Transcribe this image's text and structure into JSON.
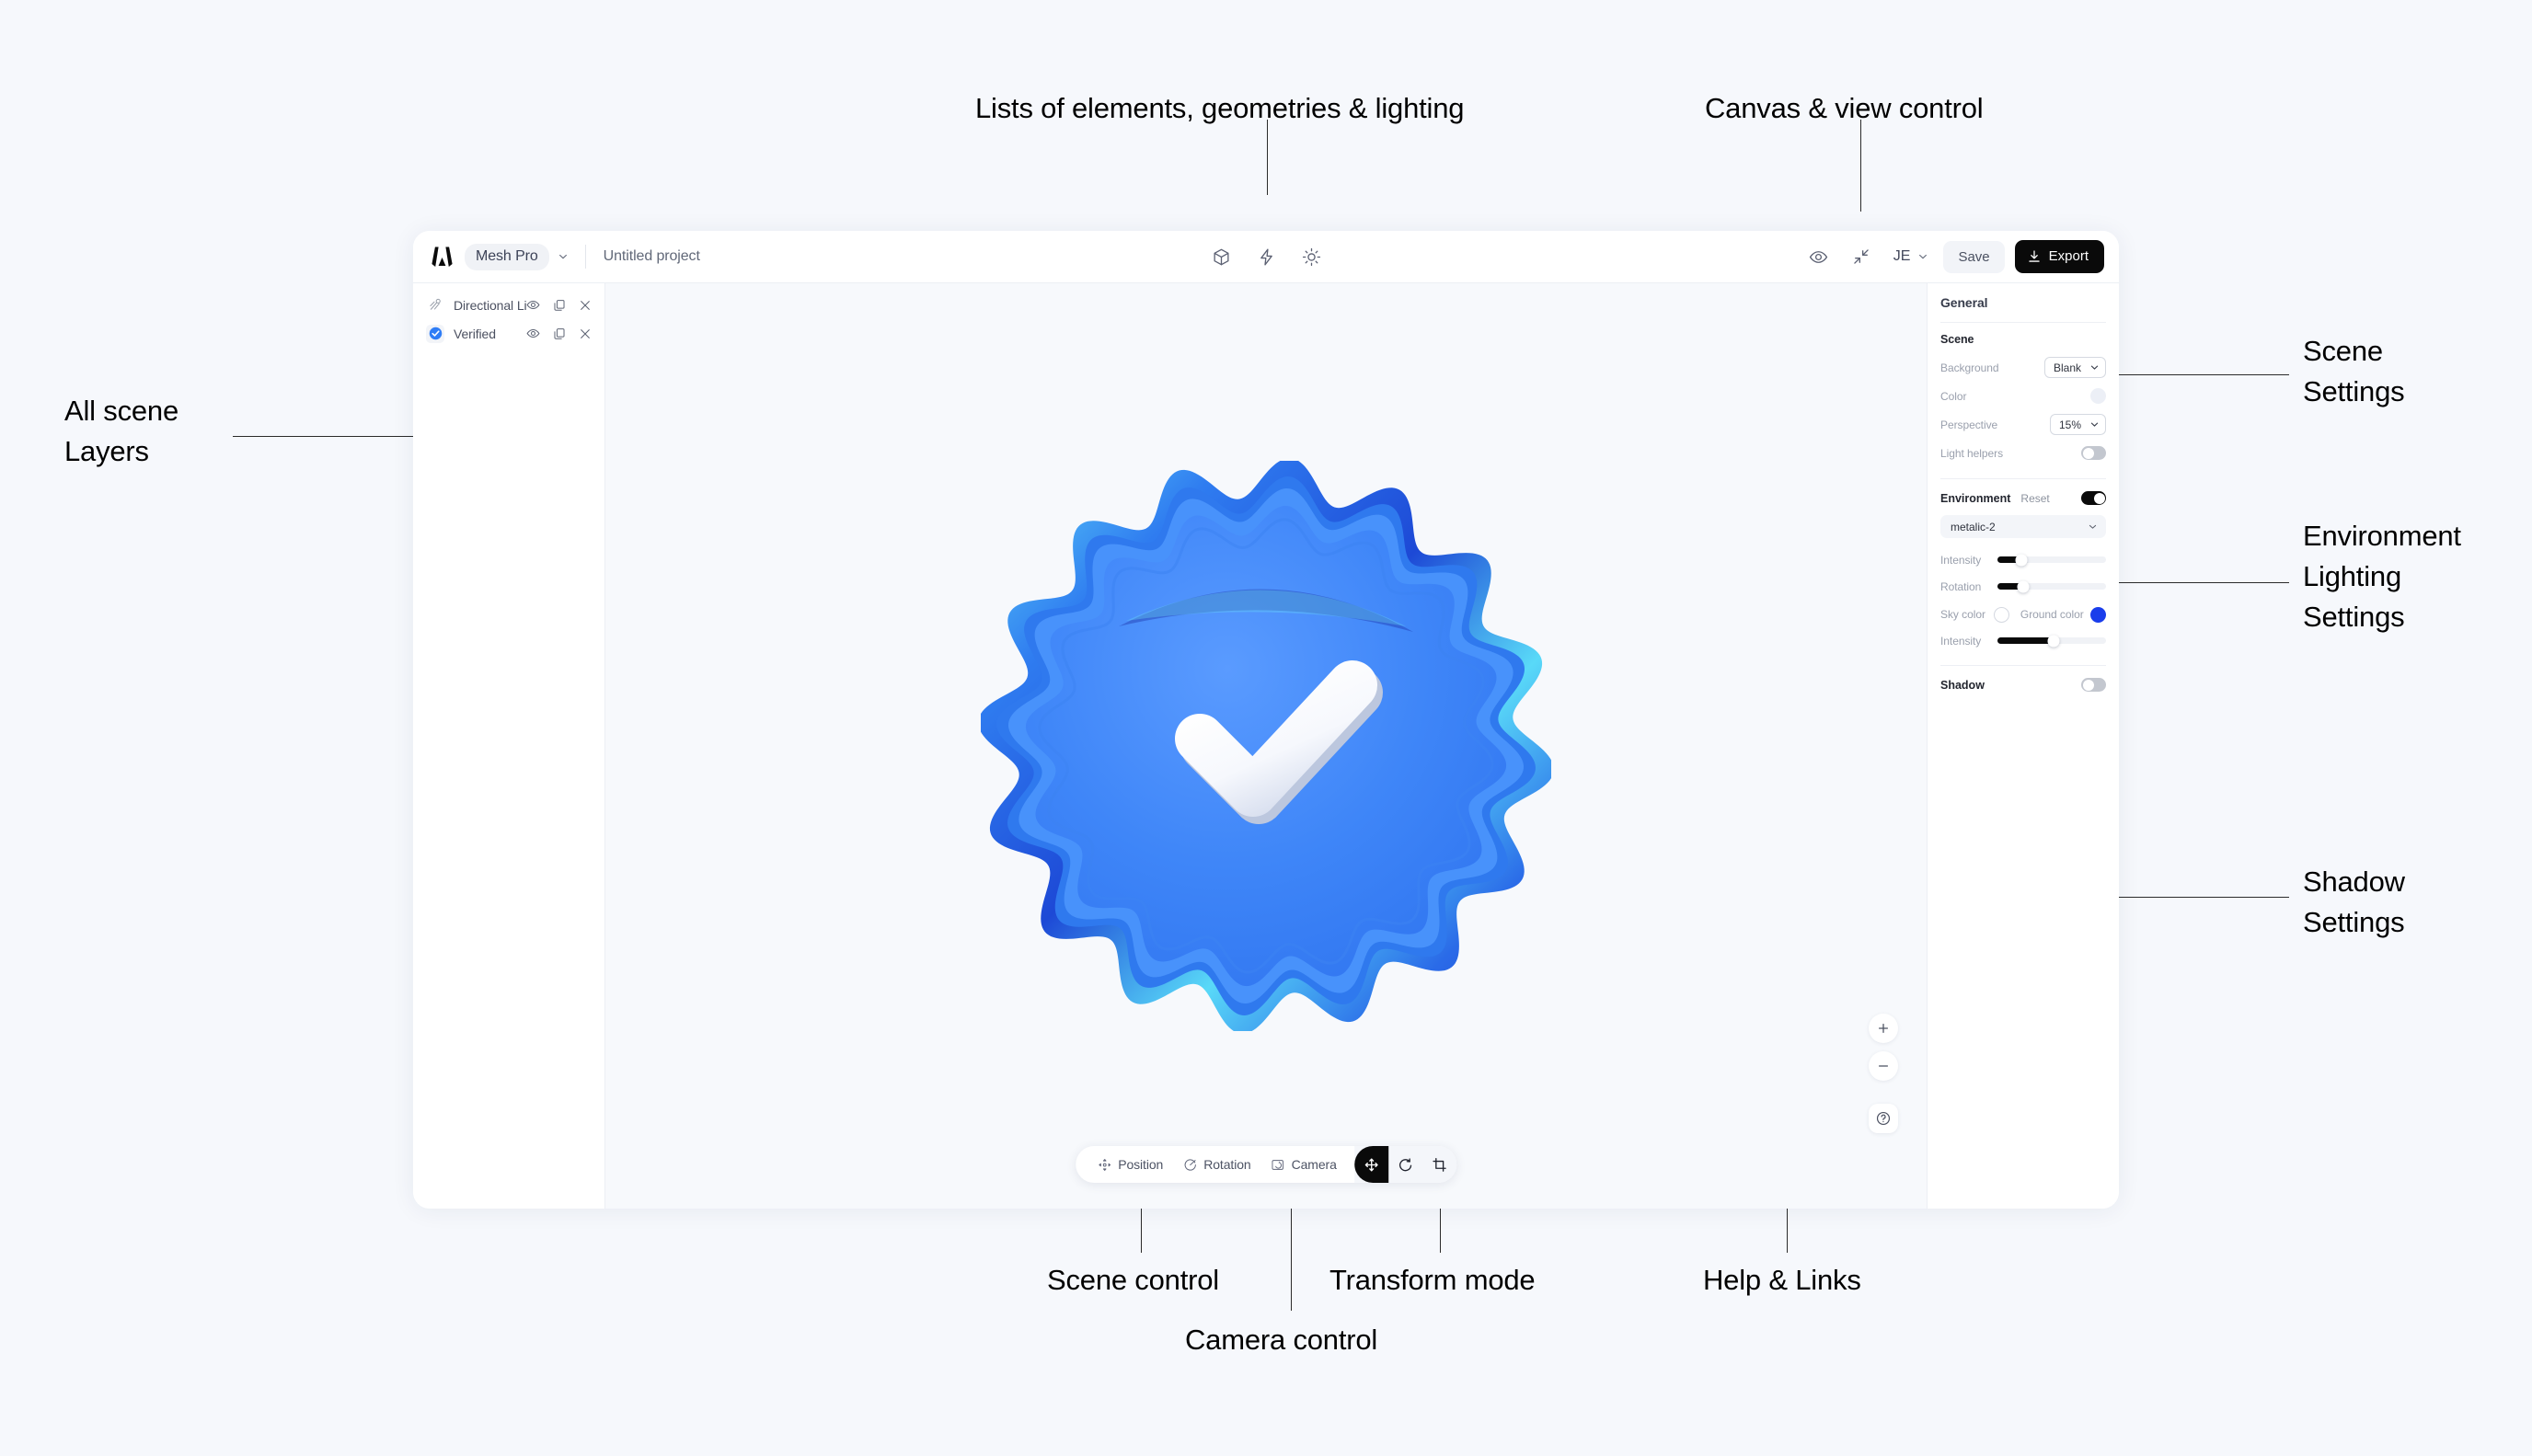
{
  "annotations": [
    {
      "id": "lists",
      "text": "Lists of elements, geometries & lighting"
    },
    {
      "id": "canvas_view",
      "text": "Canvas & view control"
    },
    {
      "id": "all_layers",
      "text": "All scene\nLayers"
    },
    {
      "id": "scene_settings",
      "text": "Scene\nSettings"
    },
    {
      "id": "env_settings",
      "text": "Environment\nLighting\nSettings"
    },
    {
      "id": "shadow_settings",
      "text": "Shadow\nSettings"
    },
    {
      "id": "scene_control",
      "text": "Scene control"
    },
    {
      "id": "camera_control",
      "text": "Camera control"
    },
    {
      "id": "transform_mode",
      "text": "Transform mode"
    },
    {
      "id": "help_links",
      "text": "Help & Links"
    }
  ],
  "topbar": {
    "logo_icon": "mesh-logo-icon",
    "brand": "Mesh Pro",
    "brand_chevron_icon": "chevron-down-icon",
    "project_name": "Untitled project",
    "center_tools": [
      {
        "icon": "cube-icon",
        "name": "geometry-tool"
      },
      {
        "icon": "lightning-icon",
        "name": "effects-tool"
      },
      {
        "icon": "sun-icon",
        "name": "lighting-tool"
      }
    ],
    "preview_icon": "eye-icon",
    "collapse_icon": "collapse-arrows-icon",
    "avatar_initials": "JE",
    "avatar_chevron_icon": "chevron-down-icon",
    "save_label": "Save",
    "export_label": "Export",
    "export_icon": "download-icon"
  },
  "layers": {
    "items": [
      {
        "name": "Directional Light",
        "thumb_icon": "directional-light-icon",
        "selected": false,
        "actions": [
          "eye-icon",
          "duplicate-icon",
          "close-icon"
        ]
      },
      {
        "name": "Verified",
        "thumb_icon": "verified-badge-icon",
        "selected": true,
        "actions": [
          "eye-icon",
          "duplicate-icon",
          "close-icon"
        ]
      }
    ]
  },
  "canvas": {
    "object_name": "verified-badge-3d-object",
    "badge_color": "#3b82f6",
    "badge_color_dark": "#1f4fd8",
    "badge_color_light": "#5ee0f5",
    "check_color": "#ffffff",
    "view_controls": [
      {
        "icon": "plus-icon",
        "name": "zoom-in-button",
        "glyph": "+"
      },
      {
        "icon": "minus-icon",
        "name": "zoom-out-button",
        "glyph": "−"
      },
      {
        "icon": "help-circle-icon",
        "name": "help-button",
        "glyph": "?"
      }
    ]
  },
  "bottom_toolbar": {
    "items": [
      {
        "label": "Position",
        "icon": "position-gizmo-icon"
      },
      {
        "label": "Rotation",
        "icon": "rotation-gizmo-icon"
      },
      {
        "label": "Camera",
        "icon": "camera-icon"
      }
    ],
    "transform_modes": [
      {
        "icon": "move-icon",
        "name": "transform-move",
        "active": true
      },
      {
        "icon": "rotate-icon",
        "name": "transform-rotate",
        "active": false
      },
      {
        "icon": "scale-crop-icon",
        "name": "transform-scale",
        "active": false
      }
    ]
  },
  "settings": {
    "title": "General",
    "scene": {
      "heading": "Scene",
      "background_label": "Background",
      "background_value": "Blank",
      "color_label": "Color",
      "color_value": "#eceff6",
      "perspective_label": "Perspective",
      "perspective_value": "15%",
      "light_helpers_label": "Light helpers",
      "light_helpers_on": false
    },
    "environment": {
      "heading": "Environment",
      "reset_label": "Reset",
      "enabled": true,
      "preset_value": "metalic-2",
      "intensity_label": "Intensity",
      "intensity_percent": 22,
      "rotation_label": "Rotation",
      "rotation_percent": 24,
      "sky_color_label": "Sky color",
      "sky_color_value": "#ffffff",
      "ground_color_label": "Ground color",
      "ground_color_value": "#1a3deb",
      "ground_intensity_label": "Intensity",
      "ground_intensity_percent": 52
    },
    "shadow": {
      "heading": "Shadow",
      "enabled": false
    }
  }
}
